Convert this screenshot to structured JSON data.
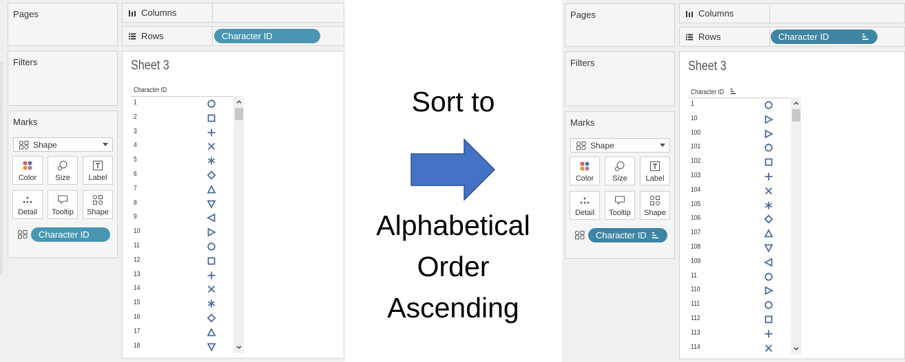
{
  "colors": {
    "pill": "#4996b2",
    "pill_dark": "#3e86a3",
    "mark": "#4a6b9a",
    "arrow_fill": "#4472c4",
    "arrow_stroke": "#2f528f"
  },
  "left": {
    "pages": "Pages",
    "filters": "Filters",
    "marks": "Marks",
    "columns": "Columns",
    "rows": "Rows",
    "rows_pill": "Character ID",
    "mark_type": "Shape",
    "buttons": {
      "color": "Color",
      "size": "Size",
      "label": "Label",
      "detail": "Detail",
      "tooltip": "Tooltip",
      "shape": "Shape"
    },
    "marks_pill": "Character ID",
    "sheet_title": "Sheet 3",
    "header": "Character ID",
    "items": [
      {
        "id": "1",
        "shape": "circle"
      },
      {
        "id": "2",
        "shape": "square"
      },
      {
        "id": "3",
        "shape": "plus"
      },
      {
        "id": "4",
        "shape": "cross"
      },
      {
        "id": "5",
        "shape": "asterisk"
      },
      {
        "id": "6",
        "shape": "diamond"
      },
      {
        "id": "7",
        "shape": "triangle-up"
      },
      {
        "id": "8",
        "shape": "triangle-down"
      },
      {
        "id": "9",
        "shape": "triangle-left"
      },
      {
        "id": "10",
        "shape": "triangle-right"
      },
      {
        "id": "11",
        "shape": "circle"
      },
      {
        "id": "12",
        "shape": "square"
      },
      {
        "id": "13",
        "shape": "plus"
      },
      {
        "id": "14",
        "shape": "cross"
      },
      {
        "id": "15",
        "shape": "asterisk"
      },
      {
        "id": "16",
        "shape": "diamond"
      },
      {
        "id": "17",
        "shape": "triangle-up"
      },
      {
        "id": "18",
        "shape": "triangle-down"
      }
    ]
  },
  "center": {
    "line1": "Sort to",
    "line2": "Alphabetical",
    "line3": "Order",
    "line4": "Ascending"
  },
  "right": {
    "pages": "Pages",
    "filters": "Filters",
    "marks": "Marks",
    "columns": "Columns",
    "rows": "Rows",
    "rows_pill": "Character ID",
    "mark_type": "Shape",
    "buttons": {
      "color": "Color",
      "size": "Size",
      "label": "Label",
      "detail": "Detail",
      "tooltip": "Tooltip",
      "shape": "Shape"
    },
    "marks_pill": "Character ID",
    "sheet_title": "Sheet 3",
    "header": "Character ID",
    "items": [
      {
        "id": "1",
        "shape": "circle"
      },
      {
        "id": "10",
        "shape": "triangle-right"
      },
      {
        "id": "100",
        "shape": "triangle-right"
      },
      {
        "id": "101",
        "shape": "circle"
      },
      {
        "id": "102",
        "shape": "square"
      },
      {
        "id": "103",
        "shape": "plus"
      },
      {
        "id": "104",
        "shape": "cross"
      },
      {
        "id": "105",
        "shape": "asterisk"
      },
      {
        "id": "106",
        "shape": "diamond"
      },
      {
        "id": "107",
        "shape": "triangle-up"
      },
      {
        "id": "108",
        "shape": "triangle-down"
      },
      {
        "id": "109",
        "shape": "triangle-left"
      },
      {
        "id": "11",
        "shape": "circle"
      },
      {
        "id": "110",
        "shape": "triangle-right"
      },
      {
        "id": "111",
        "shape": "circle"
      },
      {
        "id": "112",
        "shape": "square"
      },
      {
        "id": "113",
        "shape": "plus"
      },
      {
        "id": "114",
        "shape": "cross"
      }
    ]
  }
}
